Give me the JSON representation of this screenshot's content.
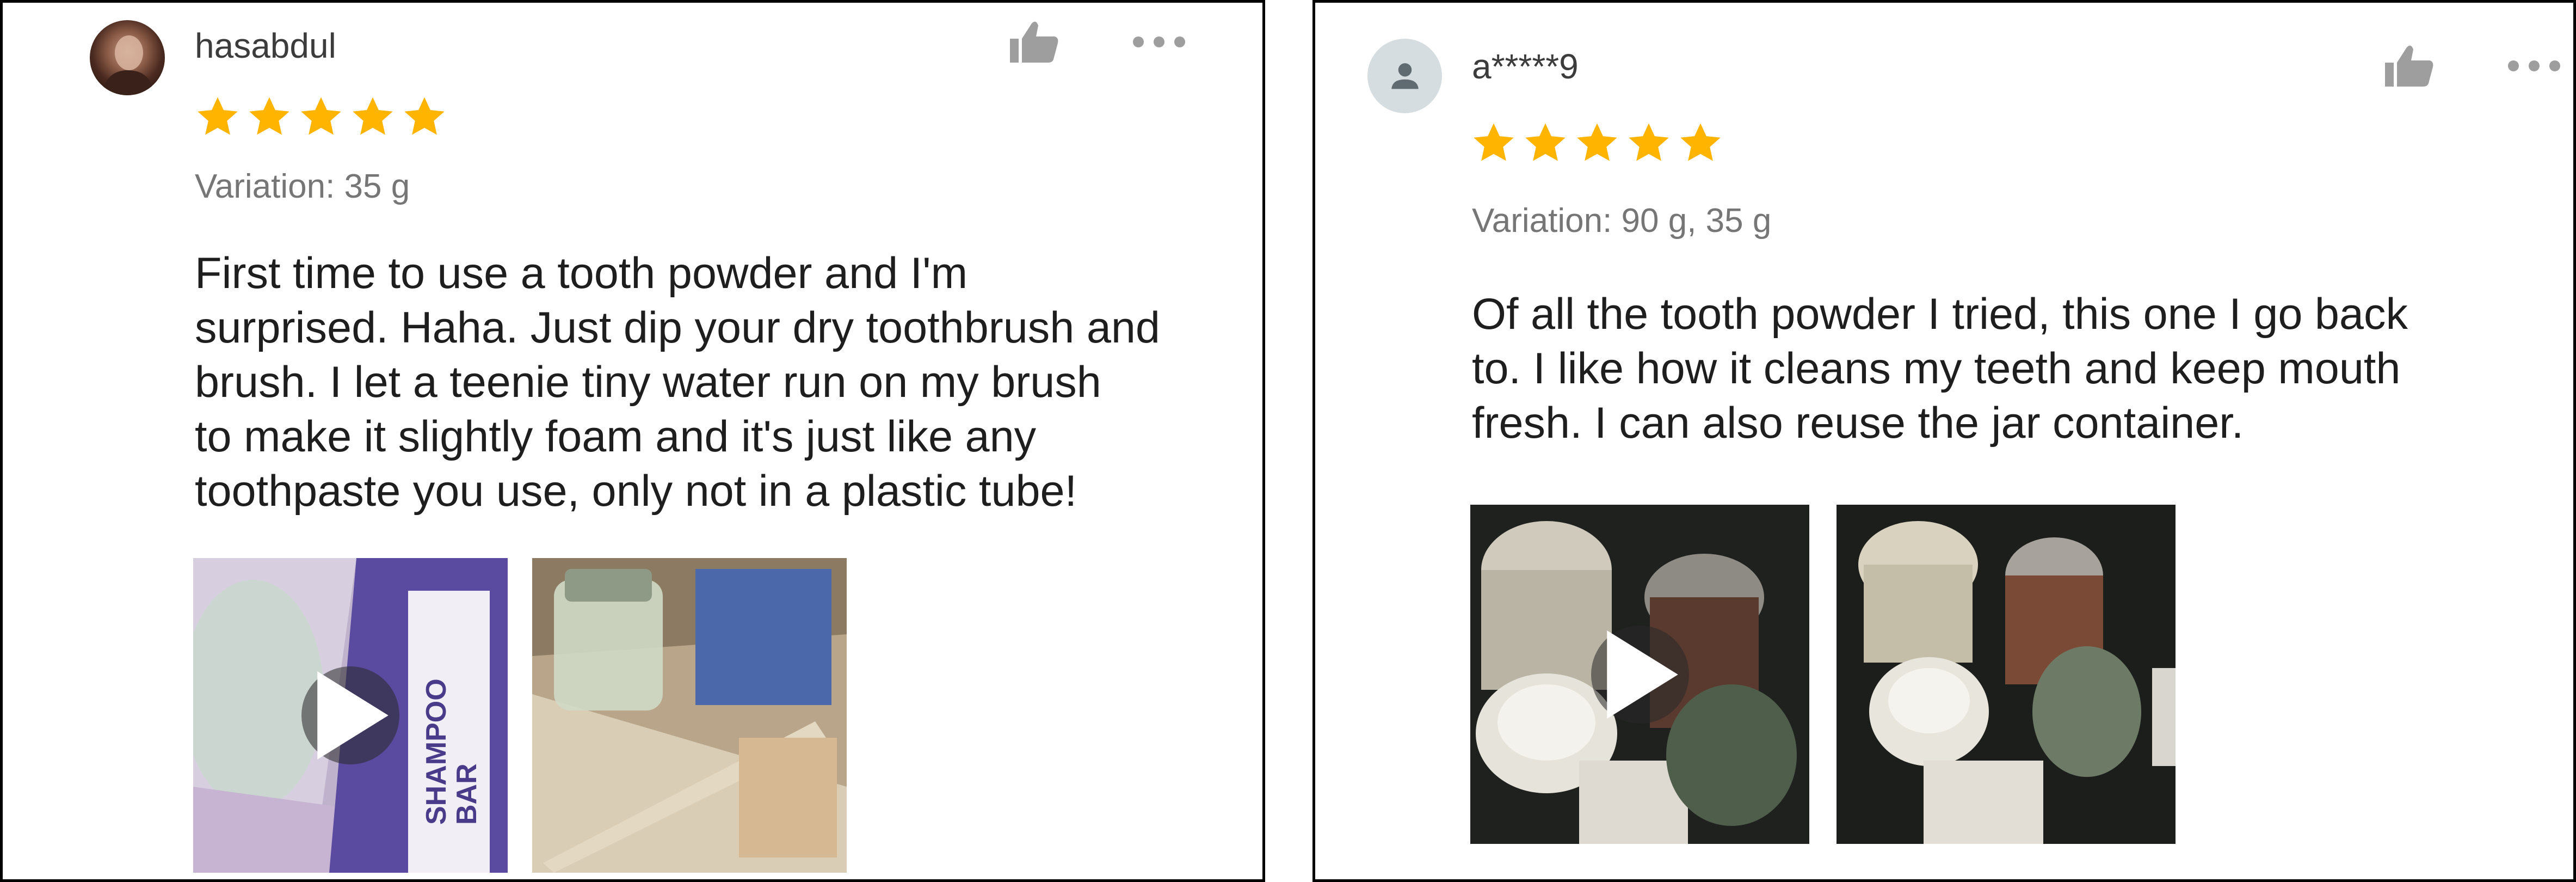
{
  "colors": {
    "star": "#FFB400",
    "icon": "#9E9E9E",
    "variation_text": "#767676",
    "border": "#000000"
  },
  "reviews": [
    {
      "username": "hasabdul",
      "rating": 5,
      "variation": "Variation: 35 g",
      "text_lines": [
        "First time to use a tooth powder and I'm",
        "surprised. Haha. Just dip your dry toothbrush and",
        "brush. I let a teenie tiny water run on my brush",
        "to make it slightly foam and it's just like any",
        "toothpaste you use, only not in a plastic tube!"
      ],
      "media": [
        {
          "kind": "video",
          "icon": "play-icon",
          "label_lines": [
            "SHAMPOO",
            "BAR"
          ]
        },
        {
          "kind": "photo"
        }
      ]
    },
    {
      "username": "a*****9",
      "rating": 5,
      "variation": "Variation: 90 g, 35 g",
      "text_lines": [
        "Of all the tooth powder I tried, this one I go back",
        "to. I like how it cleans my teeth and keep mouth",
        "fresh. I can also reuse the jar container."
      ],
      "media": [
        {
          "kind": "video",
          "icon": "play-icon"
        },
        {
          "kind": "photo"
        }
      ]
    }
  ],
  "icons": {
    "like": "thumbs-up-icon",
    "more": "more-options-icon",
    "avatar_placeholder": "person-icon",
    "star": "star-icon"
  }
}
